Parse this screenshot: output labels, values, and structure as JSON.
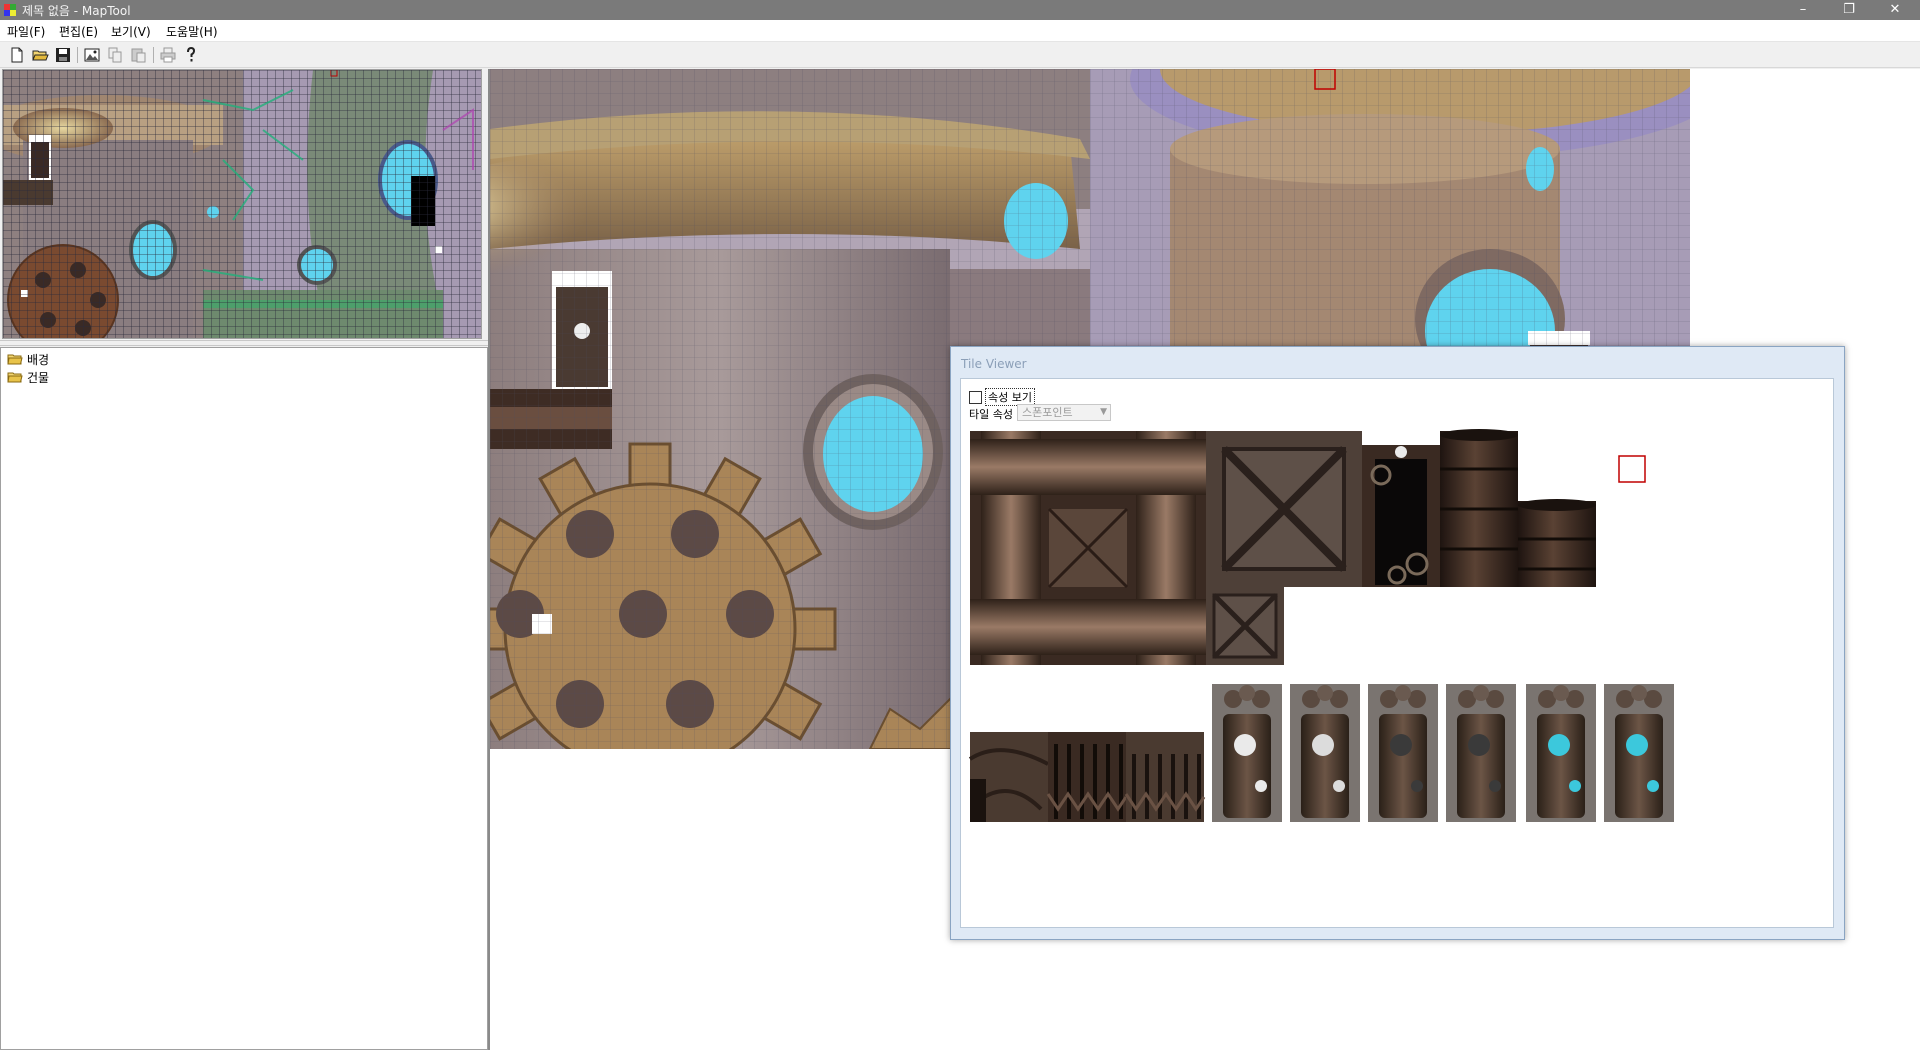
{
  "window": {
    "title": "제목 없음 - MapTool",
    "controls": {
      "minimize": "–",
      "restore": "❐",
      "close": "✕"
    }
  },
  "menu": [
    "파일(F)",
    "편집(E)",
    "보기(V)",
    "도움말(H)"
  ],
  "toolbar": {
    "icons": [
      "new-file-icon",
      "open-folder-icon",
      "save-icon",
      "image-icon",
      "copy-icon",
      "paste-icon",
      "print-icon",
      "help-icon"
    ]
  },
  "tree": {
    "items": [
      {
        "label": "배경"
      },
      {
        "label": "건물"
      }
    ]
  },
  "tile_viewer": {
    "title": "Tile Viewer",
    "show_props_label": "속성 보기",
    "show_props_checked": false,
    "tile_prop_label": "타일 속성",
    "tile_prop_value": "스폰포인트"
  },
  "colors": {
    "titlebar": "#7a7a7a",
    "selection": "#c00000",
    "porthole": "#5fd3ee",
    "metal": "#5b4433",
    "gear": "#b08a5a",
    "grid": "#3a3a5a"
  }
}
